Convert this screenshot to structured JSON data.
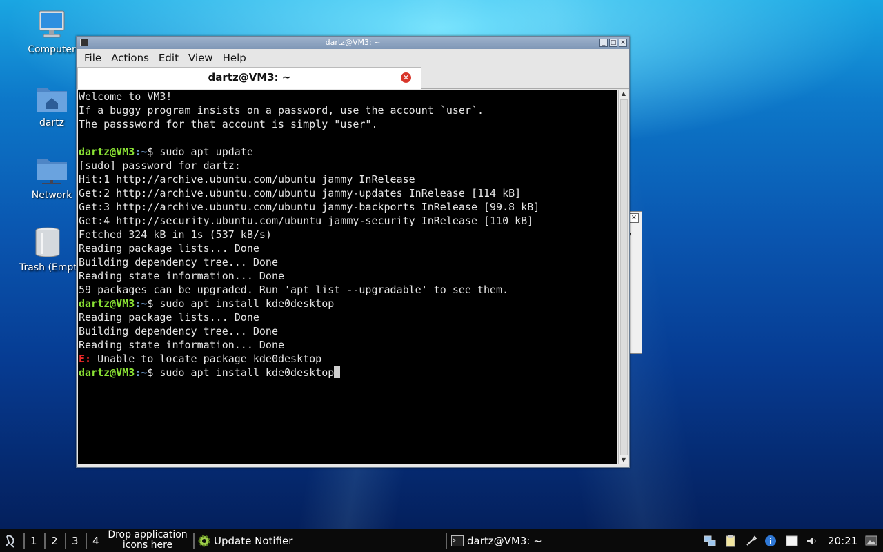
{
  "desktop": {
    "icons": [
      {
        "label": "Computer",
        "icon": "computer-icon"
      },
      {
        "label": "dartz",
        "icon": "home-folder-icon"
      },
      {
        "label": "Network",
        "icon": "network-folder-icon"
      },
      {
        "label": "Trash (Empty)",
        "icon": "trash-icon"
      }
    ]
  },
  "background_dialog": {
    "glyph": "?",
    "close": "×"
  },
  "window": {
    "title": "dartz@VM3: ~",
    "menu": [
      "File",
      "Actions",
      "Edit",
      "View",
      "Help"
    ],
    "tab_title": "dartz@VM3: ~",
    "controls": {
      "minimize": "_",
      "maximize": "□",
      "close": "×"
    }
  },
  "terminal": {
    "prompt_user": "dartz@VM3",
    "prompt_path": ":~",
    "lines": [
      {
        "t": "text",
        "s": "Welcome to VM3!"
      },
      {
        "t": "text",
        "s": "If a buggy program insists on a password, use the account `user`."
      },
      {
        "t": "text",
        "s": "The passsword for that account is simply \"user\"."
      },
      {
        "t": "text",
        "s": ""
      },
      {
        "t": "prompt",
        "s": "$ sudo apt update"
      },
      {
        "t": "text",
        "s": "[sudo] password for dartz:"
      },
      {
        "t": "text",
        "s": "Hit:1 http://archive.ubuntu.com/ubuntu jammy InRelease"
      },
      {
        "t": "text",
        "s": "Get:2 http://archive.ubuntu.com/ubuntu jammy-updates InRelease [114 kB]"
      },
      {
        "t": "text",
        "s": "Get:3 http://archive.ubuntu.com/ubuntu jammy-backports InRelease [99.8 kB]"
      },
      {
        "t": "text",
        "s": "Get:4 http://security.ubuntu.com/ubuntu jammy-security InRelease [110 kB]"
      },
      {
        "t": "text",
        "s": "Fetched 324 kB in 1s (537 kB/s)"
      },
      {
        "t": "text",
        "s": "Reading package lists... Done"
      },
      {
        "t": "text",
        "s": "Building dependency tree... Done"
      },
      {
        "t": "text",
        "s": "Reading state information... Done"
      },
      {
        "t": "text",
        "s": "59 packages can be upgraded. Run 'apt list --upgradable' to see them."
      },
      {
        "t": "prompt",
        "s": "$ sudo apt install kde0desktop"
      },
      {
        "t": "text",
        "s": "Reading package lists... Done"
      },
      {
        "t": "text",
        "s": "Building dependency tree... Done"
      },
      {
        "t": "text",
        "s": "Reading state information... Done"
      },
      {
        "t": "error",
        "e": "E:",
        "s": " Unable to locate package kde0desktop"
      },
      {
        "t": "input",
        "s": "$ sudo apt install kde0desktop"
      }
    ]
  },
  "taskbar": {
    "workspaces": [
      "1",
      "2",
      "3",
      "4"
    ],
    "drop_text": "Drop application icons here",
    "tasks": [
      {
        "label": "Update Notifier",
        "icon": "gear-icon"
      },
      {
        "label": "dartz@VM3: ~",
        "icon": "terminal-icon"
      }
    ],
    "tray_icons": [
      "network-icon",
      "clipboard-icon",
      "tools-icon",
      "info-icon",
      "notes-icon",
      "volume-icon"
    ],
    "clock": "20:21"
  }
}
